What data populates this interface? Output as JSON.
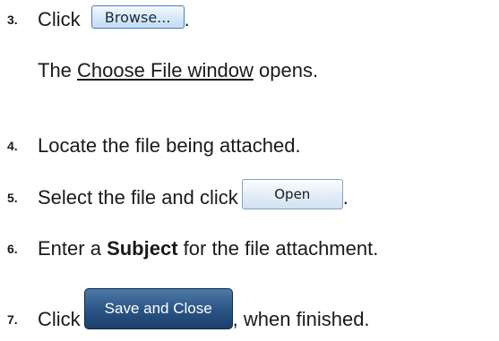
{
  "steps": [
    {
      "number": "3.",
      "before": "Click",
      "button": "Browse...",
      "after": "."
    },
    {
      "number": "4.",
      "text": "Locate the file being attached."
    },
    {
      "number": "5.",
      "before": "Select the file and click",
      "button": "Open",
      "after": "."
    },
    {
      "number": "6.",
      "before": "Enter a",
      "bold": "Subject",
      "after": "for the file attachment."
    },
    {
      "number": "7.",
      "before": "Click",
      "button": "Save and Close",
      "after": ", when finished."
    }
  ],
  "note": {
    "before": "The",
    "link": "Choose File window",
    "after": "opens."
  }
}
